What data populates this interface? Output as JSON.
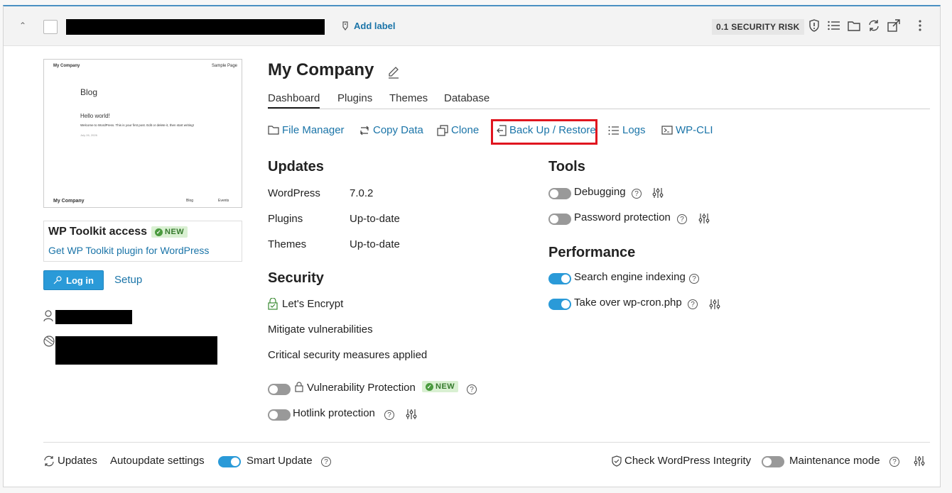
{
  "header": {
    "add_label": "Add label",
    "security_risk": "0.1 SECURITY RISK"
  },
  "preview": {
    "site_name_top": "My Company",
    "sample_page": "Sample Page",
    "blog": "Blog",
    "hello": "Hello world!",
    "welcome": "Welcome to WordPress. This is your first post. Edit or delete it, then start writing!",
    "date": "July 26, 2026",
    "site_name_bottom": "My Company",
    "footer_blog": "Blog",
    "footer_events": "Events"
  },
  "wp_toolkit": {
    "title": "WP Toolkit access",
    "badge": "NEW",
    "link": "Get WP Toolkit plugin for WordPress"
  },
  "buttons": {
    "login": "Log in",
    "setup": "Setup"
  },
  "site": {
    "title": "My Company"
  },
  "tabs": [
    "Dashboard",
    "Plugins",
    "Themes",
    "Database"
  ],
  "actions": [
    "File Manager",
    "Copy Data",
    "Clone",
    "Back Up / Restore",
    "Logs",
    "WP-CLI"
  ],
  "updates": {
    "heading": "Updates",
    "rows": [
      {
        "label": "WordPress",
        "value": "7.0.2"
      },
      {
        "label": "Plugins",
        "value": "Up-to-date"
      },
      {
        "label": "Themes",
        "value": "Up-to-date"
      }
    ]
  },
  "security": {
    "heading": "Security",
    "ssl": "Let's Encrypt",
    "mitigate": "Mitigate vulnerabilities",
    "critical": "Critical security measures applied",
    "vuln_protection": "Vulnerability Protection",
    "vuln_badge": "NEW",
    "hotlink": "Hotlink protection"
  },
  "tools": {
    "heading": "Tools",
    "debugging": "Debugging",
    "password": "Password protection"
  },
  "performance": {
    "heading": "Performance",
    "indexing": "Search engine indexing",
    "cron": "Take over wp-cron.php"
  },
  "footer": {
    "updates": "Updates",
    "autoupdate": "Autoupdate settings",
    "smart_update": "Smart Update",
    "integrity": "Check WordPress Integrity",
    "maintenance": "Maintenance mode"
  },
  "toggles": {
    "debugging": false,
    "password": false,
    "indexing": true,
    "cron": true,
    "vuln": false,
    "hotlink": false,
    "smart_update": true,
    "maintenance": false
  }
}
